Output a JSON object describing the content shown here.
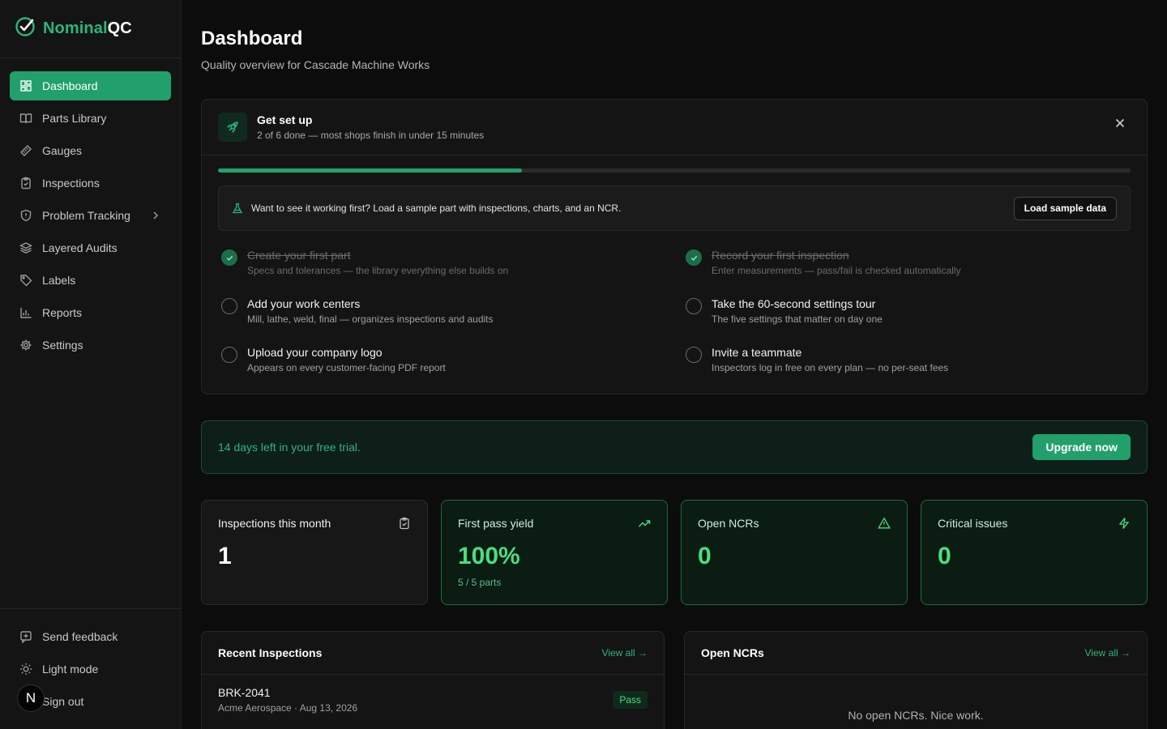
{
  "brand": {
    "name_a": "Nominal",
    "name_b": "QC"
  },
  "sidebar": {
    "items": [
      {
        "label": "Dashboard",
        "icon": "dashboard-icon"
      },
      {
        "label": "Parts Library",
        "icon": "book-icon"
      },
      {
        "label": "Gauges",
        "icon": "ruler-icon"
      },
      {
        "label": "Inspections",
        "icon": "clipboard-icon"
      },
      {
        "label": "Problem Tracking",
        "icon": "shield-icon"
      },
      {
        "label": "Layered Audits",
        "icon": "layers-icon"
      },
      {
        "label": "Labels",
        "icon": "tag-icon"
      },
      {
        "label": "Reports",
        "icon": "bar-chart-icon"
      },
      {
        "label": "Settings",
        "icon": "gear-icon"
      }
    ],
    "bottom": [
      {
        "label": "Send feedback",
        "icon": "feedback-icon"
      },
      {
        "label": "Light mode",
        "icon": "sun-icon"
      },
      {
        "label": "Sign out",
        "icon": "sign-out-icon"
      }
    ],
    "avatar_letter": "N"
  },
  "header": {
    "title": "Dashboard",
    "subtitle": "Quality overview for Cascade Machine Works"
  },
  "setup": {
    "title": "Get set up",
    "subtitle": "2 of 6 done — most shops finish in under 15 minutes",
    "progress_fraction": 0.333,
    "sample_text": "Want to see it working first? Load a sample part with inspections, charts, and an NCR.",
    "sample_button": "Load sample data",
    "tasks": [
      {
        "title": "Create your first part",
        "desc": "Specs and tolerances — the library everything else builds on",
        "done": true
      },
      {
        "title": "Record your first inspection",
        "desc": "Enter measurements — pass/fail is checked automatically",
        "done": true
      },
      {
        "title": "Add your work centers",
        "desc": "Mill, lathe, weld, final — organizes inspections and audits",
        "done": false
      },
      {
        "title": "Take the 60-second settings tour",
        "desc": "The five settings that matter on day one",
        "done": false
      },
      {
        "title": "Upload your company logo",
        "desc": "Appears on every customer-facing PDF report",
        "done": false
      },
      {
        "title": "Invite a teammate",
        "desc": "Inspectors log in free on every plan — no per-seat fees",
        "done": false
      }
    ]
  },
  "trial": {
    "text": "14 days left in your free trial.",
    "button": "Upgrade now"
  },
  "stats": [
    {
      "label": "Inspections this month",
      "value": "1",
      "sub": "",
      "icon": "clipboard-check-icon",
      "style": "plain"
    },
    {
      "label": "First pass yield",
      "value": "100%",
      "sub": "5 / 5 parts",
      "icon": "trending-up-icon",
      "style": "green"
    },
    {
      "label": "Open NCRs",
      "value": "0",
      "sub": "",
      "icon": "warning-icon",
      "style": "green"
    },
    {
      "label": "Critical issues",
      "value": "0",
      "sub": "",
      "icon": "lightning-icon",
      "style": "green"
    }
  ],
  "recent": {
    "title": "Recent Inspections",
    "link": "View all →",
    "rows": [
      {
        "title": "BRK-2041",
        "meta": "Acme Aerospace · Aug 13, 2026",
        "status": "Pass"
      }
    ]
  },
  "ncrs": {
    "title": "Open NCRs",
    "link": "View all →",
    "empty": "No open NCRs. Nice work."
  },
  "colors": {
    "accent": "#22a06b",
    "accent_text": "#2db57c",
    "bright_green": "#4ade80"
  }
}
